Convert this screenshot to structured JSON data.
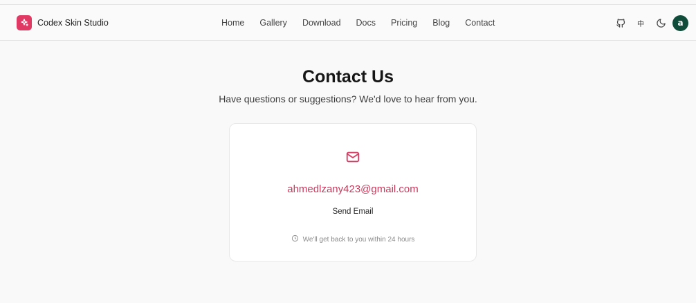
{
  "app": {
    "name": "Codex Skin Studio"
  },
  "nav": {
    "links": [
      {
        "label": "Home"
      },
      {
        "label": "Gallery"
      },
      {
        "label": "Download"
      },
      {
        "label": "Docs"
      },
      {
        "label": "Pricing"
      },
      {
        "label": "Blog"
      },
      {
        "label": "Contact"
      }
    ],
    "language_label": "中",
    "avatar_initial": "a"
  },
  "contact": {
    "title": "Contact Us",
    "subtitle": "Have questions or suggestions? We'd love to hear from you.",
    "email": "ahmedlzany423@gmail.com",
    "send_label": "Send Email",
    "response_note": "We'll get back to you within 24 hours"
  },
  "colors": {
    "brand": "#e03a64",
    "email_link": "#c9395b",
    "avatar_bg": "#0f4c3a",
    "background": "#f9f9f9"
  },
  "icons": [
    "sparkle-icon",
    "github-icon",
    "moon-icon",
    "mail-icon",
    "clock-icon"
  ]
}
